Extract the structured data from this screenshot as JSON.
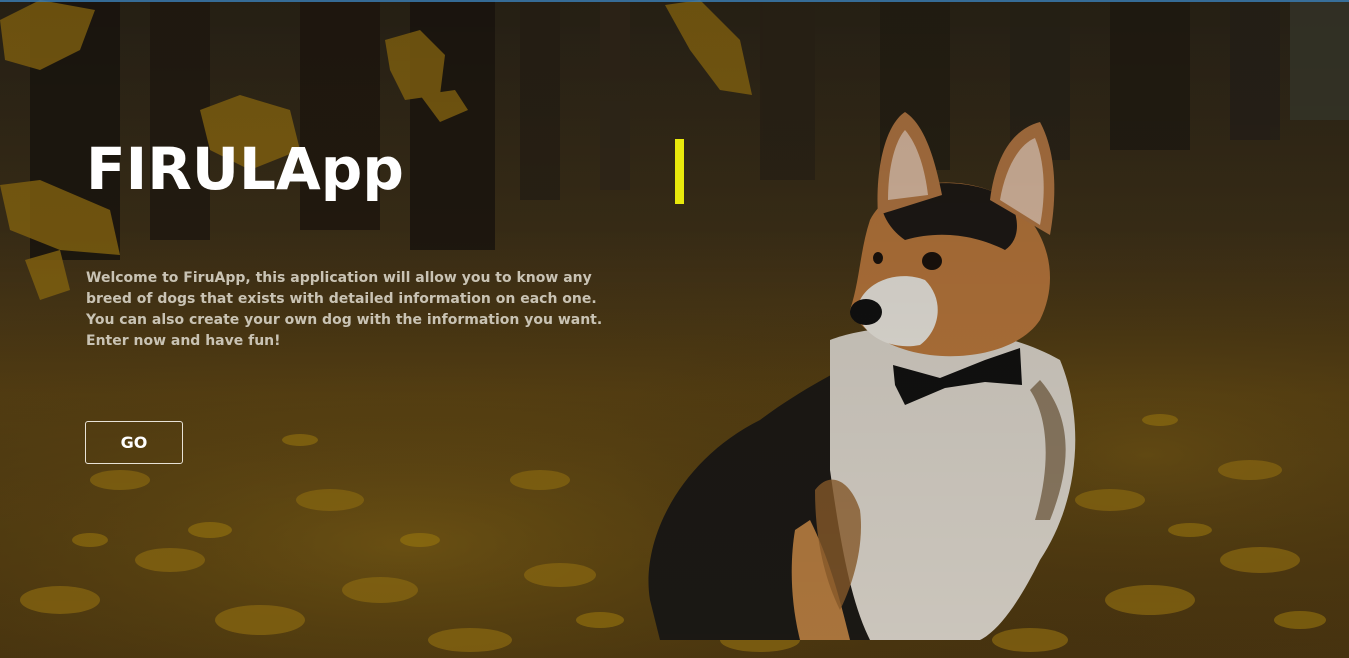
{
  "hero": {
    "title": "FIRULApp",
    "intro_lines": [
      "Welcome to FiruApp, this application will allow you to know any",
      "breed of dogs that exists with detailed information on each one.",
      "You can also create your own dog with the information you want.",
      "Enter now and have fun!"
    ],
    "go_label": "GO",
    "background_image": "corgi-in-autumn-leaves"
  },
  "colors": {
    "accent": "#e8e80c",
    "title": "#ffffff",
    "body_text": "#c9c3b4",
    "button_border": "#e8e2d6"
  }
}
